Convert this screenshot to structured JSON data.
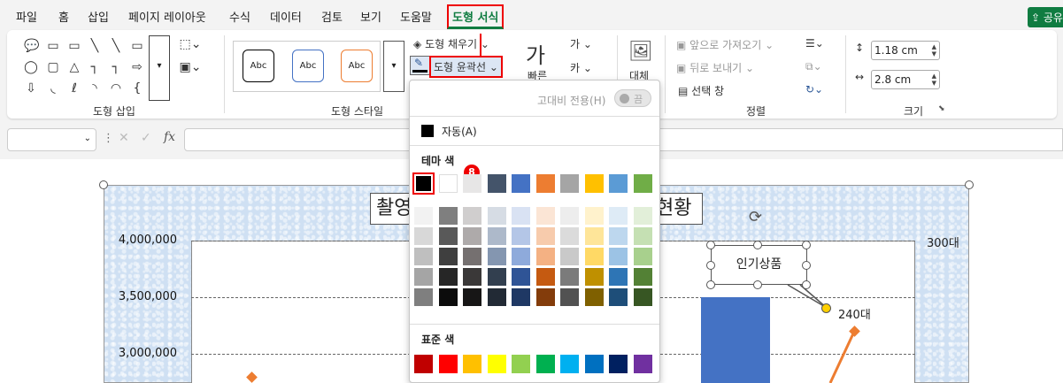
{
  "menu": {
    "items": [
      "파일",
      "홈",
      "삽입",
      "페이지 레이아웃",
      "수식",
      "데이터",
      "검토",
      "보기",
      "도움말",
      "도형 서식"
    ],
    "active": "도형 서식",
    "share_label": "공유"
  },
  "ribbon": {
    "groups": {
      "insert_shapes": "도형 삽입",
      "shape_styles": "도형 스타일",
      "arrange": "정렬",
      "size": "크기"
    },
    "style_samples": [
      "Abc",
      "Abc",
      "Abc"
    ],
    "fill_label": "도형 채우기",
    "outline_label": "도형 윤곽선",
    "quick_styles_label": "빠른",
    "alt_text_label": "대체",
    "bring_forward": "앞으로 가져오기",
    "send_backward": "뒤로 보내기",
    "selection_pane": "선택 창",
    "height_value": "1.18 cm",
    "width_value": "2.8 cm"
  },
  "formula": {
    "fx": "fx"
  },
  "dropdown": {
    "high_contrast_label": "고대비 전용(H)",
    "toggle_label": "끔",
    "automatic_label": "자동(A)",
    "theme_label": "테마 색",
    "standard_label": "표준 색",
    "step_badge": "8",
    "theme_top": [
      "#000000",
      "#ffffff",
      "#e7e6e6",
      "#44546a",
      "#4472c4",
      "#ed7d31",
      "#a5a5a5",
      "#ffc000",
      "#5b9bd5",
      "#70ad47"
    ],
    "theme_shades": [
      [
        "#f2f2f2",
        "#7f7f7f",
        "#d0cece",
        "#d6dce4",
        "#d9e2f3",
        "#fbe5d5",
        "#ededed",
        "#fff2cc",
        "#deebf6",
        "#e2efd9"
      ],
      [
        "#d8d8d8",
        "#595959",
        "#aeaaaa",
        "#adb9ca",
        "#b4c6e7",
        "#f7cbac",
        "#dbdbdb",
        "#fee599",
        "#bdd7ee",
        "#c5e0b3"
      ],
      [
        "#bfbfbf",
        "#3f3f3f",
        "#757070",
        "#8496b0",
        "#8eaadb",
        "#f4b183",
        "#c9c9c9",
        "#ffd965",
        "#9cc3e5",
        "#a8d08d"
      ],
      [
        "#a5a5a5",
        "#262626",
        "#3a3838",
        "#323f4f",
        "#2f5496",
        "#c55a11",
        "#7b7b7b",
        "#bf9000",
        "#2e75b5",
        "#538135"
      ],
      [
        "#7f7f7f",
        "#0c0c0c",
        "#171616",
        "#222a35",
        "#1f3864",
        "#833c0b",
        "#525252",
        "#7f6000",
        "#1e4e79",
        "#375623"
      ]
    ],
    "standard": [
      "#c00000",
      "#ff0000",
      "#ffc000",
      "#ffff00",
      "#92d050",
      "#00b050",
      "#00b0f0",
      "#0070c0",
      "#002060",
      "#7030a0"
    ]
  },
  "chart": {
    "title_left": "촬영",
    "title_right": "현황",
    "y_ticks": [
      "4,000,000",
      "3,500,000",
      "3,000,000"
    ],
    "y2_tick": "300대",
    "callout_label": "인기상품",
    "data_label": "240대",
    "bar_color": "#4472c4",
    "line_color": "#ed7d31"
  }
}
